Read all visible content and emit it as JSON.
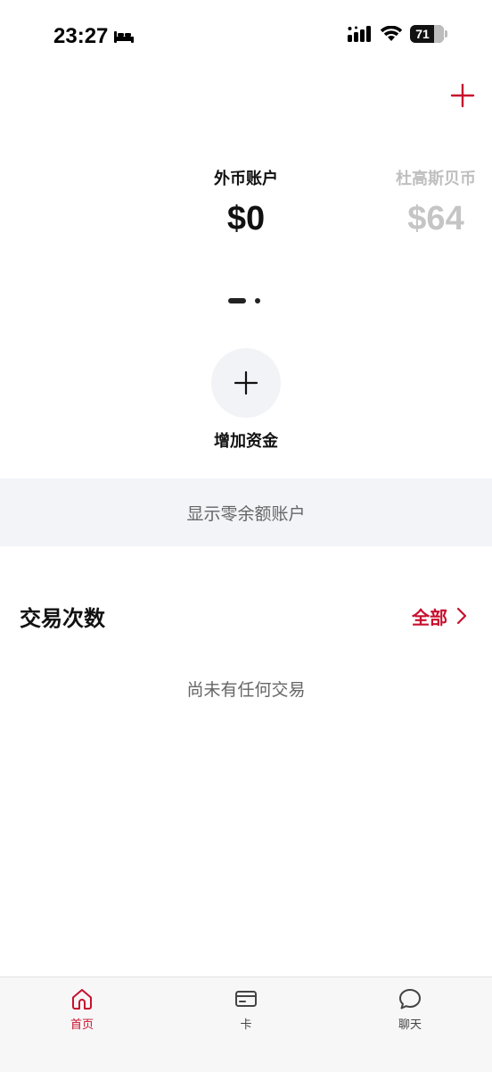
{
  "status_bar": {
    "time": "23:27",
    "battery": "71",
    "battery_level": 0.71
  },
  "accounts": {
    "current": {
      "name": "外币账户",
      "balance": "$0"
    },
    "next": {
      "name": "杜高斯贝币",
      "balance": "$64"
    },
    "pages": 2,
    "active_page": 1
  },
  "add_funds": {
    "label": "增加资金"
  },
  "show_zero_accounts": {
    "label": "显示零余额账户"
  },
  "transactions": {
    "title": "交易次数",
    "all_label": "全部",
    "empty_text": "尚未有任何交易"
  },
  "tabbar": {
    "items": [
      {
        "label": "首页",
        "icon": "home-icon",
        "active": true
      },
      {
        "label": "卡",
        "icon": "card-icon",
        "active": false
      },
      {
        "label": "聊天",
        "icon": "chat-icon",
        "active": false
      }
    ]
  },
  "colors": {
    "accent": "#c8102e",
    "muted_bg": "#f3f4f8"
  }
}
